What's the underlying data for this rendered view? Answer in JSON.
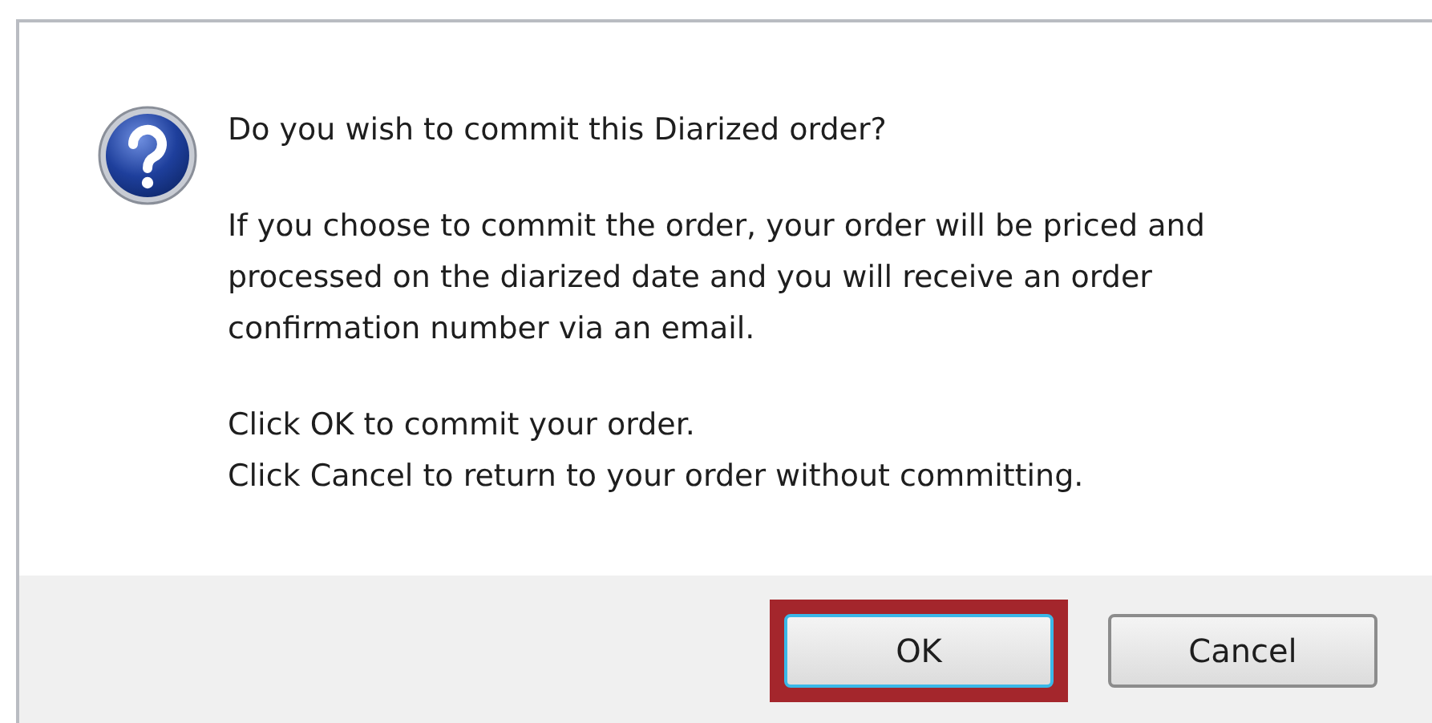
{
  "dialog": {
    "heading": "Do you wish to commit this Diarized order?",
    "paragraphs": [
      [
        "If you choose to commit the order, your order will be priced and",
        "processed on the diarized date and you will receive an order",
        "confirmation number via an email."
      ],
      [
        "Click OK to commit your order.",
        "Click Cancel to return to your order without committing."
      ]
    ],
    "buttons": [
      {
        "label": "OK",
        "focused": true,
        "highlighted": true
      },
      {
        "label": "Cancel",
        "focused": false,
        "highlighted": false
      }
    ]
  }
}
